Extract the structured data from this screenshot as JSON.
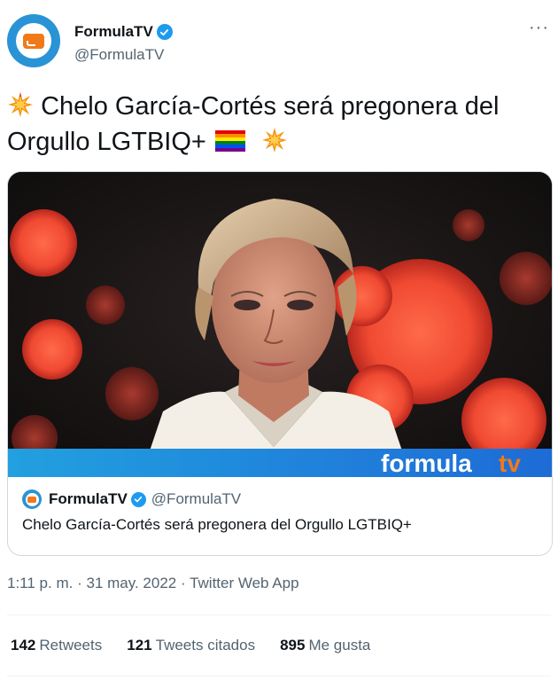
{
  "author": {
    "display_name": "FormulaTV",
    "handle": "@FormulaTV",
    "avatar_icon": "tv-icon",
    "verified_icon": "verified-badge-icon"
  },
  "more_menu": {
    "label": "···",
    "icon": "more-icon"
  },
  "tweet": {
    "text": "Chelo García-Cortés será pregonera del Orgullo LGTBIQ+",
    "emojis": [
      "collision-emoji",
      "rainbow-flag-emoji",
      "collision-emoji"
    ]
  },
  "card": {
    "image_overlay_text_a": "formula",
    "image_overlay_text_b": "tv",
    "site_name": "FormulaTV",
    "site_handle": "@FormulaTV",
    "title": "Chelo García-Cortés será pregonera del Orgullo LGTBIQ+"
  },
  "meta": {
    "time": "1:11 p. m.",
    "separator": "·",
    "date": "31 may. 2022",
    "source": "Twitter Web App"
  },
  "stats": {
    "retweets_count": "142",
    "retweets_label": "Retweets",
    "quotes_count": "121",
    "quotes_label": "Tweets citados",
    "likes_count": "895",
    "likes_label": "Me gusta"
  },
  "colors": {
    "accent": "#1d9bf0",
    "brand_blue": "#2a93d5",
    "brand_orange": "#f07a1a",
    "secondary_text": "#536471"
  }
}
